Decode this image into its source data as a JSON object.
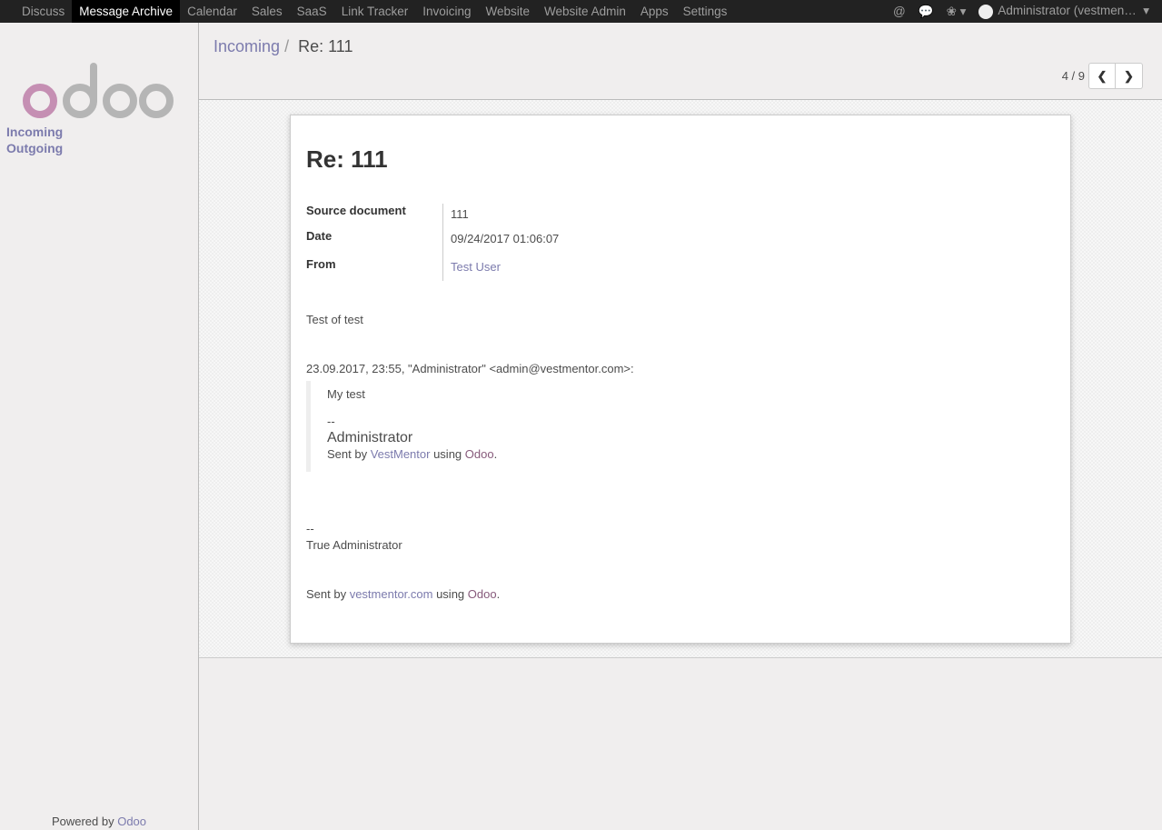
{
  "topbar": {
    "menu": [
      "Discuss",
      "Message Archive",
      "Calendar",
      "Sales",
      "SaaS",
      "Link Tracker",
      "Invoicing",
      "Website",
      "Website Admin",
      "Apps",
      "Settings"
    ],
    "active": "Message Archive",
    "user": "Administrator (vestmen…"
  },
  "sidebar": {
    "items": [
      "Incoming",
      "Outgoing"
    ],
    "powered_prefix": "Powered by ",
    "powered_link": "Odoo"
  },
  "breadcrumb": {
    "parent": "Incoming",
    "sep": "/",
    "current": "Re: 111"
  },
  "pager": {
    "value": "4 / 9"
  },
  "record": {
    "title": "Re: 111",
    "fields": [
      {
        "label": "Source document",
        "value": "111"
      },
      {
        "label": "Date",
        "value": "09/24/2017 01:06:07"
      },
      {
        "label": "From",
        "value": "Test User"
      }
    ],
    "body": {
      "p1": "Test of test",
      "quote_header": "23.09.2017, 23:55, \"Administrator\" <admin@vestmentor.com>:",
      "q1": "My test",
      "q_sep": "--",
      "q_name": "Administrator",
      "q_sent": "Sent by ",
      "q_company": "VestMentor",
      "q_using": " using ",
      "q_odoo": "Odoo",
      "q_dot": ".",
      "sig_sep": "--",
      "sig_name": "True Administrator",
      "sent": "Sent by ",
      "company": "vestmentor.com",
      "using": " using ",
      "odoo": "Odoo",
      "dot": "."
    }
  }
}
